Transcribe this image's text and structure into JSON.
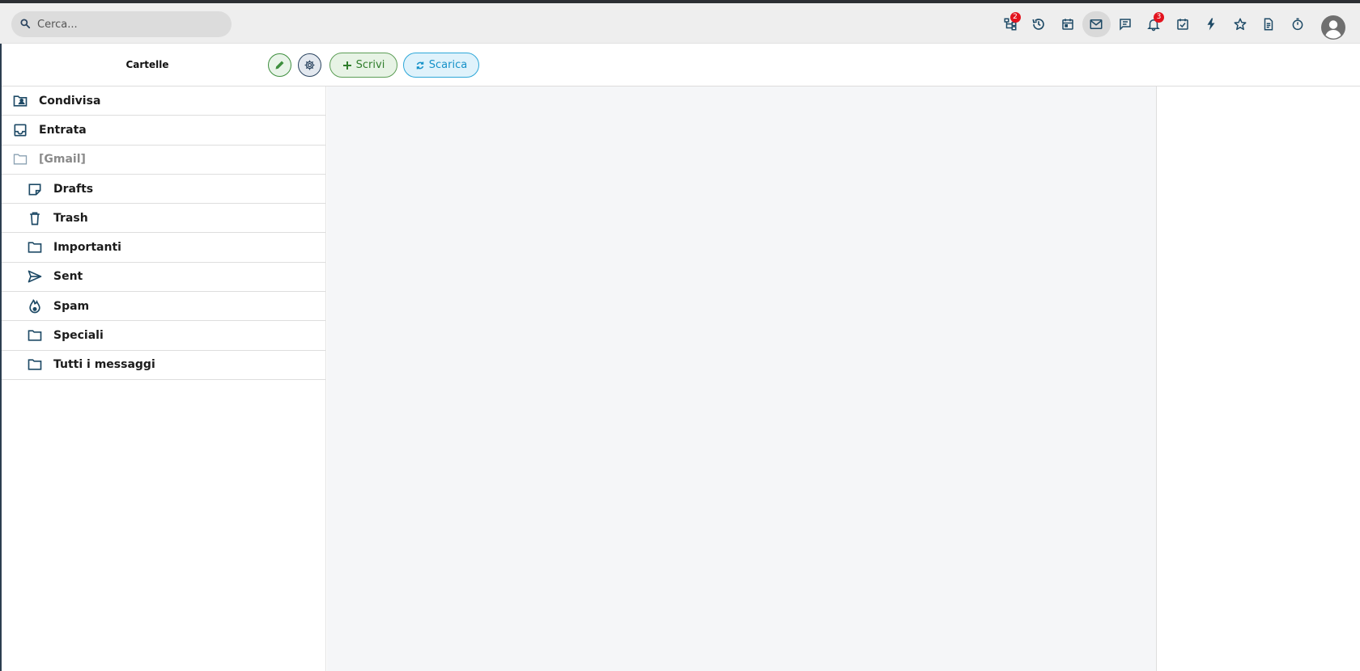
{
  "search": {
    "placeholder": "Cerca..."
  },
  "topbar": {
    "icons": [
      {
        "name": "org-chart-icon",
        "badge": "2"
      },
      {
        "name": "history-icon",
        "badge": ""
      },
      {
        "name": "calendar-icon",
        "badge": ""
      },
      {
        "name": "mail-icon",
        "badge": "",
        "active": true
      },
      {
        "name": "chat-icon",
        "badge": ""
      },
      {
        "name": "bell-icon",
        "badge": "3"
      },
      {
        "name": "task-check-icon",
        "badge": ""
      },
      {
        "name": "lightning-icon",
        "badge": ""
      },
      {
        "name": "star-icon",
        "badge": ""
      },
      {
        "name": "document-icon",
        "badge": ""
      },
      {
        "name": "stopwatch-icon",
        "badge": ""
      }
    ]
  },
  "toolbar": {
    "folders_title": "Cartelle",
    "write_label": "Scrivi",
    "download_label": "Scarica"
  },
  "folders": [
    {
      "label": "Condivisa",
      "icon": "shared-folder-icon",
      "level": 0
    },
    {
      "label": "Entrata",
      "icon": "inbox-icon",
      "level": 0
    },
    {
      "label": "[Gmail]",
      "icon": "folder-icon",
      "level": 0,
      "muted": true
    },
    {
      "label": "Drafts",
      "icon": "draft-icon",
      "level": 1
    },
    {
      "label": "Trash",
      "icon": "trash-icon",
      "level": 1
    },
    {
      "label": "Importanti",
      "icon": "folder-icon",
      "level": 1
    },
    {
      "label": "Sent",
      "icon": "send-icon",
      "level": 1
    },
    {
      "label": "Spam",
      "icon": "spam-icon",
      "level": 1
    },
    {
      "label": "Speciali",
      "icon": "folder-icon",
      "level": 1
    },
    {
      "label": "Tutti i messaggi",
      "icon": "folder-icon",
      "level": 1
    }
  ],
  "colors": {
    "icon": "#1e4a66",
    "badge": "#e3131e",
    "write_accent": "#2f7d2b",
    "download_accent": "#1591c8"
  }
}
